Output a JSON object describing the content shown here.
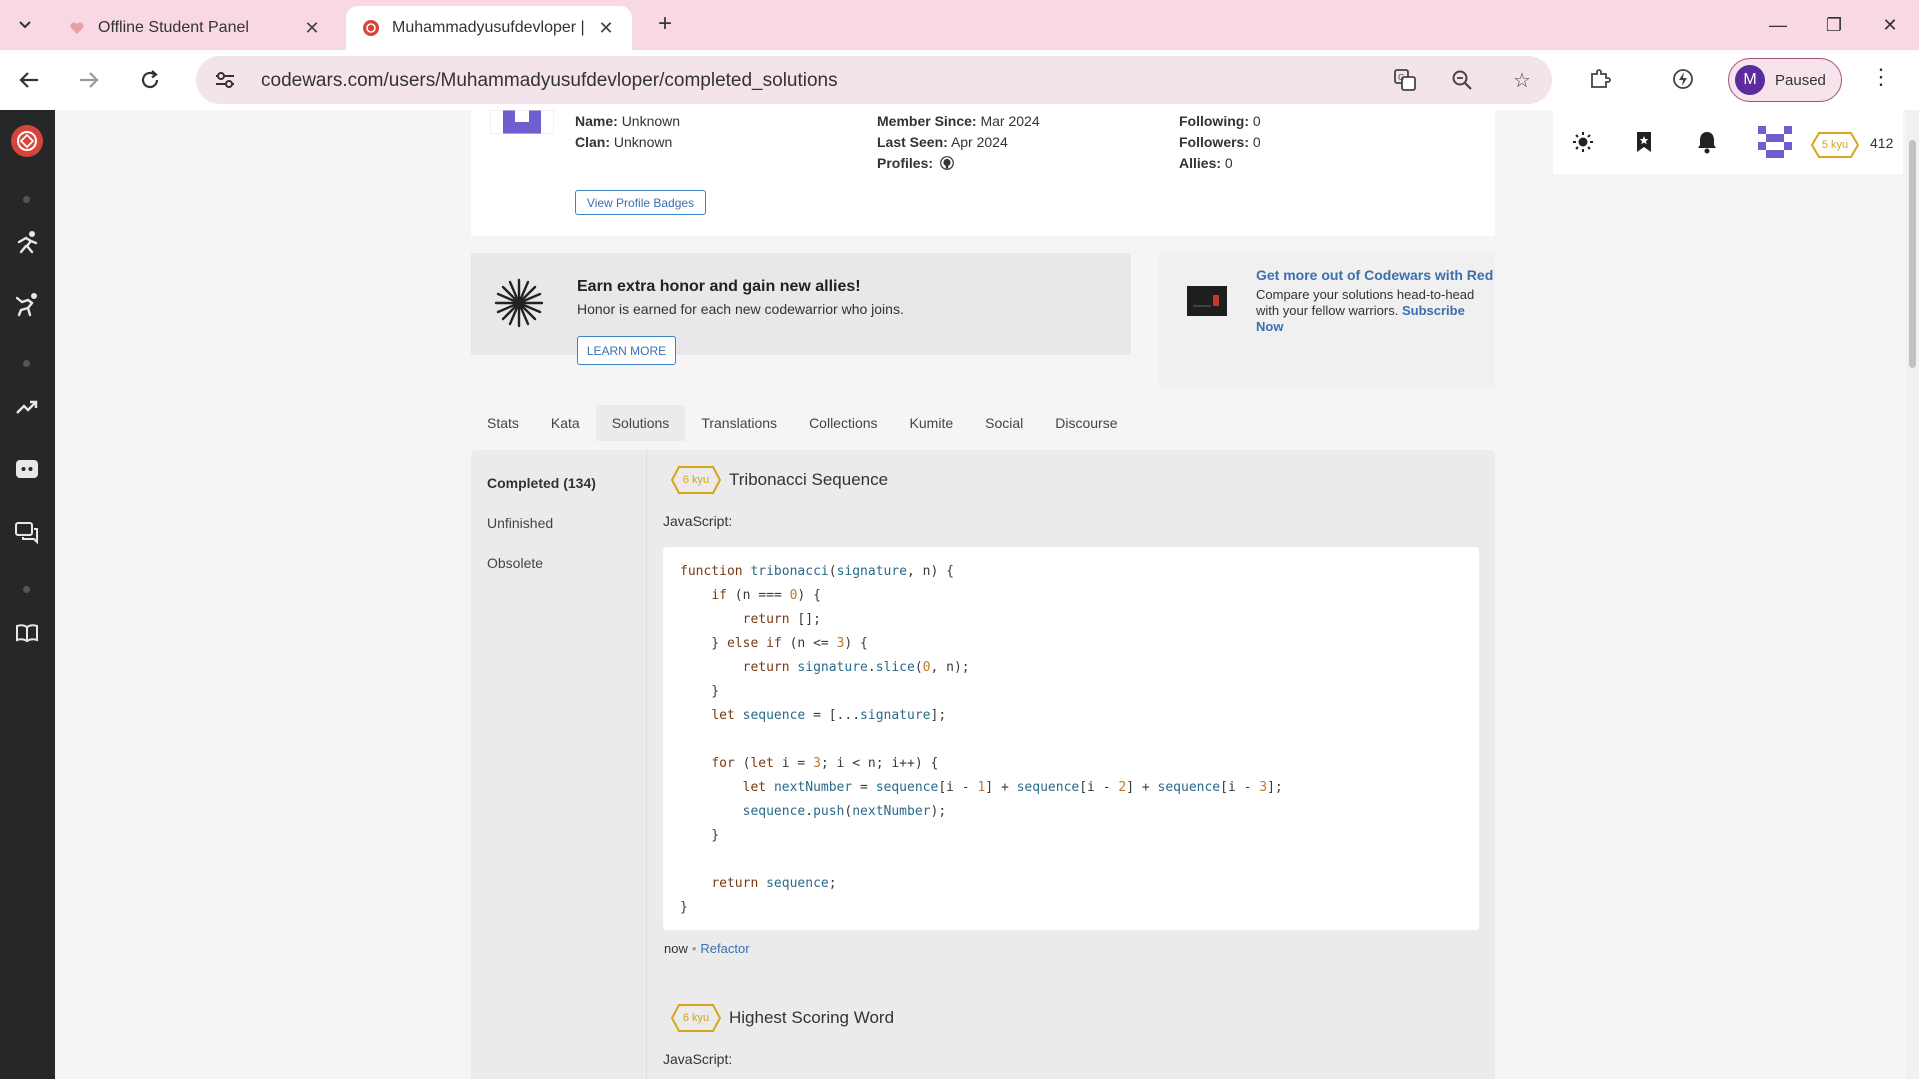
{
  "browser": {
    "tabs": [
      {
        "title": "Offline Student Panel"
      },
      {
        "title": "Muhammadyusufdevloper |"
      }
    ],
    "url": "codewars.com/users/Muhammadyusufdevloper/completed_solutions",
    "profile": {
      "initial": "M",
      "label": "Paused"
    }
  },
  "colors": {
    "accent_red": "#d6443a",
    "link_blue": "#3b6fb0",
    "kyu_yellow": "#d8a41a",
    "rail_bg": "#262729",
    "avatar_purple": "#6d5fd0"
  },
  "utility_bar": {
    "icons": [
      "sun-icon",
      "bookmark-icon",
      "bell-icon",
      "avatar-icon"
    ],
    "rank": "5 kyu",
    "honor": "412"
  },
  "profile_card": {
    "col1": [
      {
        "label": "Name:",
        "value": "Unknown"
      },
      {
        "label": "Clan:",
        "value": "Unknown"
      }
    ],
    "col2": [
      {
        "label": "Member Since:",
        "value": "Mar 2024"
      },
      {
        "label": "Last Seen:",
        "value": "Apr 2024"
      },
      {
        "label": "Profiles:",
        "value": ""
      }
    ],
    "col3": [
      {
        "label": "Following:",
        "value": "0"
      },
      {
        "label": "Followers:",
        "value": "0"
      },
      {
        "label": "Allies:",
        "value": "0"
      }
    ],
    "badges_button": "View Profile Badges"
  },
  "promo": {
    "title": "Earn extra honor and gain new allies!",
    "subtitle": "Honor is earned for each new codewarrior who joins.",
    "button": "LEARN MORE"
  },
  "red_promo": {
    "title": "Get more out of Codewars with Red",
    "text": "Compare your solutions head-to-head with your fellow warriors.",
    "link": "Subscribe Now"
  },
  "profile_tabs": [
    "Stats",
    "Kata",
    "Solutions",
    "Translations",
    "Collections",
    "Kumite",
    "Social",
    "Discourse"
  ],
  "solutions_sidebar": [
    {
      "label": "Completed (134)"
    },
    {
      "label": "Unfinished"
    },
    {
      "label": "Obsolete"
    }
  ],
  "solutions": [
    {
      "rank": "6 kyu",
      "name": "Tribonacci Sequence",
      "language": "JavaScript:",
      "code": [
        "function tribonacci(signature, n) {",
        "    if (n === 0) {",
        "        return [];",
        "    } else if (n <= 3) {",
        "        return signature.slice(0, n);",
        "    }",
        "    let sequence = [...signature];",
        "",
        "    for (let i = 3; i < n; i++) {",
        "        let nextNumber = sequence[i - 1] + sequence[i - 2] + sequence[i - 3];",
        "        sequence.push(nextNumber);",
        "    }",
        "",
        "    return sequence;",
        "}"
      ],
      "time": "now",
      "action": "Refactor"
    },
    {
      "rank": "6 kyu",
      "name": "Highest Scoring Word",
      "language": "JavaScript:"
    }
  ]
}
